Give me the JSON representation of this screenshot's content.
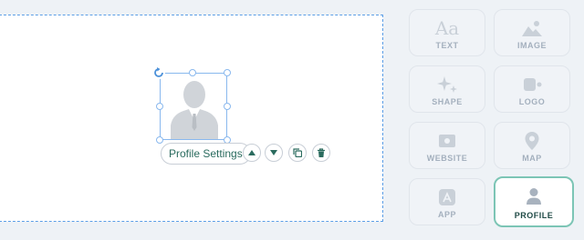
{
  "editor": {
    "selected_element": "profile",
    "toolbar": {
      "settings_label": "Profile Settings",
      "move_up_icon": "triangle-up-icon",
      "move_down_icon": "triangle-down-icon",
      "duplicate_icon": "copy-icon",
      "delete_icon": "trash-icon"
    }
  },
  "palette": {
    "accent": "#7cc5b5",
    "items": [
      {
        "label": "TEXT",
        "icon": "text-aa-icon"
      },
      {
        "label": "IMAGE",
        "icon": "image-icon"
      },
      {
        "label": "SHAPE",
        "icon": "sparkle-icon"
      },
      {
        "label": "LOGO",
        "icon": "logo-icon"
      },
      {
        "label": "WEBSITE",
        "icon": "website-icon"
      },
      {
        "label": "MAP",
        "icon": "map-pin-icon"
      },
      {
        "label": "APP",
        "icon": "app-store-icon"
      },
      {
        "label": "PROFILE",
        "icon": "person-icon",
        "active": true
      }
    ]
  }
}
